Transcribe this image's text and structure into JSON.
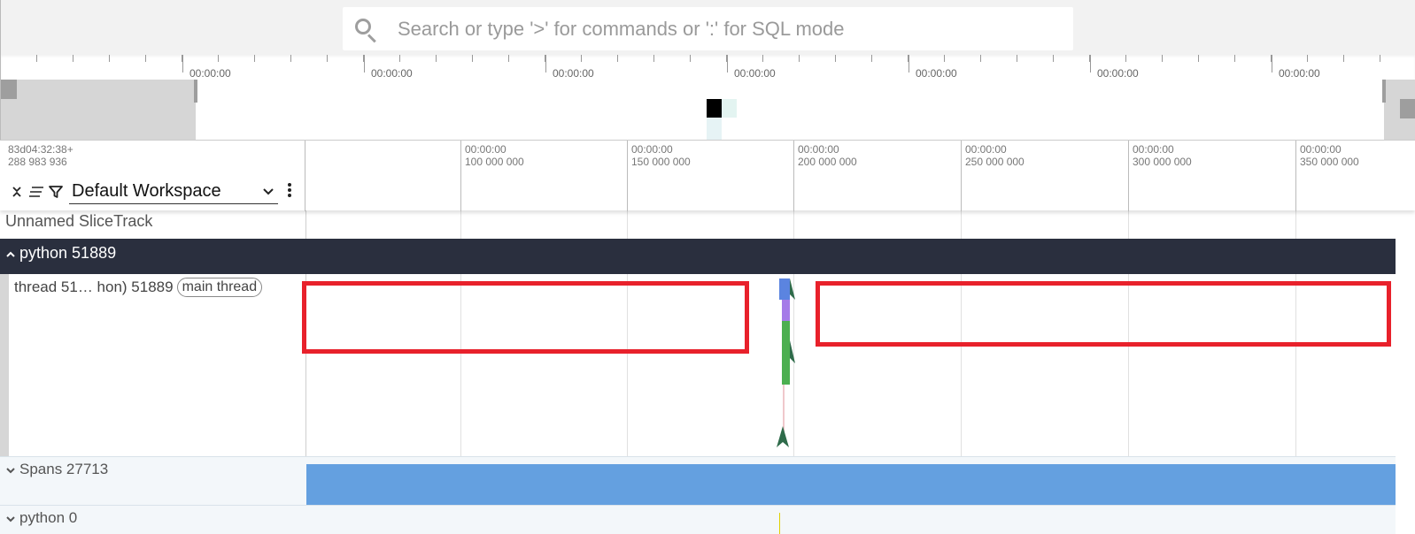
{
  "search": {
    "placeholder": "Search or type '>' for commands or ':' for SQL mode"
  },
  "overview": {
    "tick_labels": [
      "00:00:00",
      "00:00:00",
      "00:00:00",
      "00:00:00",
      "00:00:00",
      "00:00:00",
      "00:00:00"
    ]
  },
  "ruler": {
    "offset_line1": "83d04:32:38+",
    "offset_line2": "288 983 936",
    "ticks": [
      {
        "top": "00:00:00",
        "bottom": "100 000 000"
      },
      {
        "top": "00:00:00",
        "bottom": "150 000 000"
      },
      {
        "top": "00:00:00",
        "bottom": "200 000 000"
      },
      {
        "top": "00:00:00",
        "bottom": "250 000 000"
      },
      {
        "top": "00:00:00",
        "bottom": "300 000 000"
      },
      {
        "top": "00:00:00",
        "bottom": "350 000 000"
      }
    ]
  },
  "workspace": {
    "selected": "Default Workspace"
  },
  "tracks": {
    "unnamed": "Unnamed SliceTrack",
    "group_python": "python 51889",
    "thread_name": "thread 51… hon) 51889",
    "thread_badge": "main thread",
    "spans": "Spans 27713",
    "python0": "python 0"
  },
  "icons": {
    "search": "search-icon",
    "collapse_all": "collapse-all-icon",
    "list": "list-icon",
    "filter": "filter-icon",
    "more": "more-vert-icon",
    "chevron_up": "chevron-up-icon",
    "chevron_down": "chevron-down-icon"
  },
  "colors": {
    "highlight_box": "#e8212b",
    "group_header": "#2a2f3e",
    "spans_bar": "#64a0e0"
  }
}
